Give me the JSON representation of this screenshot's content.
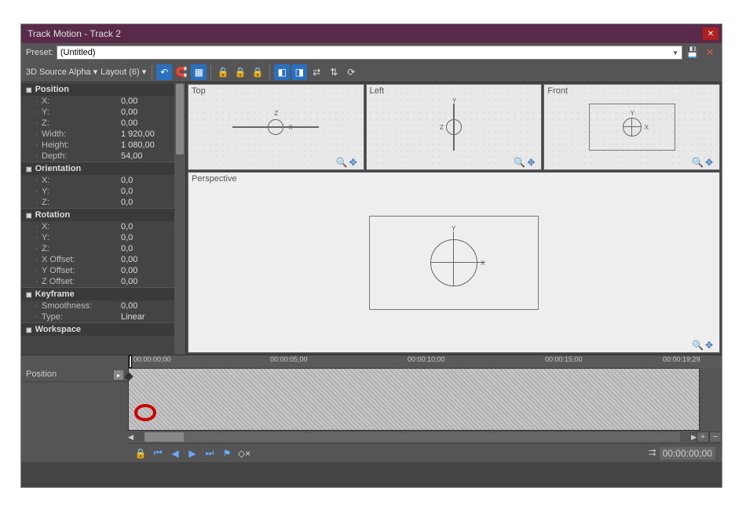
{
  "window": {
    "title": "Track Motion - Track 2"
  },
  "preset": {
    "label": "Preset:",
    "value": "(Untitled)"
  },
  "toolbar": {
    "mode": "3D Source Alpha",
    "layout": "Layout (6)"
  },
  "sections": {
    "position": {
      "title": "Position",
      "x": {
        "label": "X:",
        "value": "0,00"
      },
      "y": {
        "label": "Y:",
        "value": "0,00"
      },
      "z": {
        "label": "Z:",
        "value": "0,00"
      },
      "width": {
        "label": "Width:",
        "value": "1 920,00"
      },
      "height": {
        "label": "Height:",
        "value": "1 080,00"
      },
      "depth": {
        "label": "Depth:",
        "value": "54,00"
      }
    },
    "orientation": {
      "title": "Orientation",
      "x": {
        "label": "X:",
        "value": "0,0"
      },
      "y": {
        "label": "Y:",
        "value": "0,0"
      },
      "z": {
        "label": "Z:",
        "value": "0,0"
      }
    },
    "rotation": {
      "title": "Rotation",
      "x": {
        "label": "X:",
        "value": "0,0"
      },
      "y": {
        "label": "Y:",
        "value": "0,0"
      },
      "z": {
        "label": "Z:",
        "value": "0,0"
      },
      "xoff": {
        "label": "X Offset:",
        "value": "0,00"
      },
      "yoff": {
        "label": "Y Offset:",
        "value": "0,00"
      },
      "zoff": {
        "label": "Z Offset:",
        "value": "0,00"
      }
    },
    "keyframe": {
      "title": "Keyframe",
      "smoothness": {
        "label": "Smoothness:",
        "value": "0,00"
      },
      "type": {
        "label": "Type:",
        "value": "Linear"
      }
    },
    "workspace": {
      "title": "Workspace"
    }
  },
  "viewports": {
    "top": "Top",
    "left": "Left",
    "front": "Front",
    "perspective": "Perspective"
  },
  "axis": {
    "x": "X",
    "y": "Y",
    "z": "Z"
  },
  "timeline": {
    "track_label": "Position",
    "ticks": [
      "00:00:00;00",
      "00:00:05;00",
      "00:00:10;00",
      "00:00:15;00",
      "00:00:19;29"
    ],
    "current_time": "00:00:00;00"
  }
}
